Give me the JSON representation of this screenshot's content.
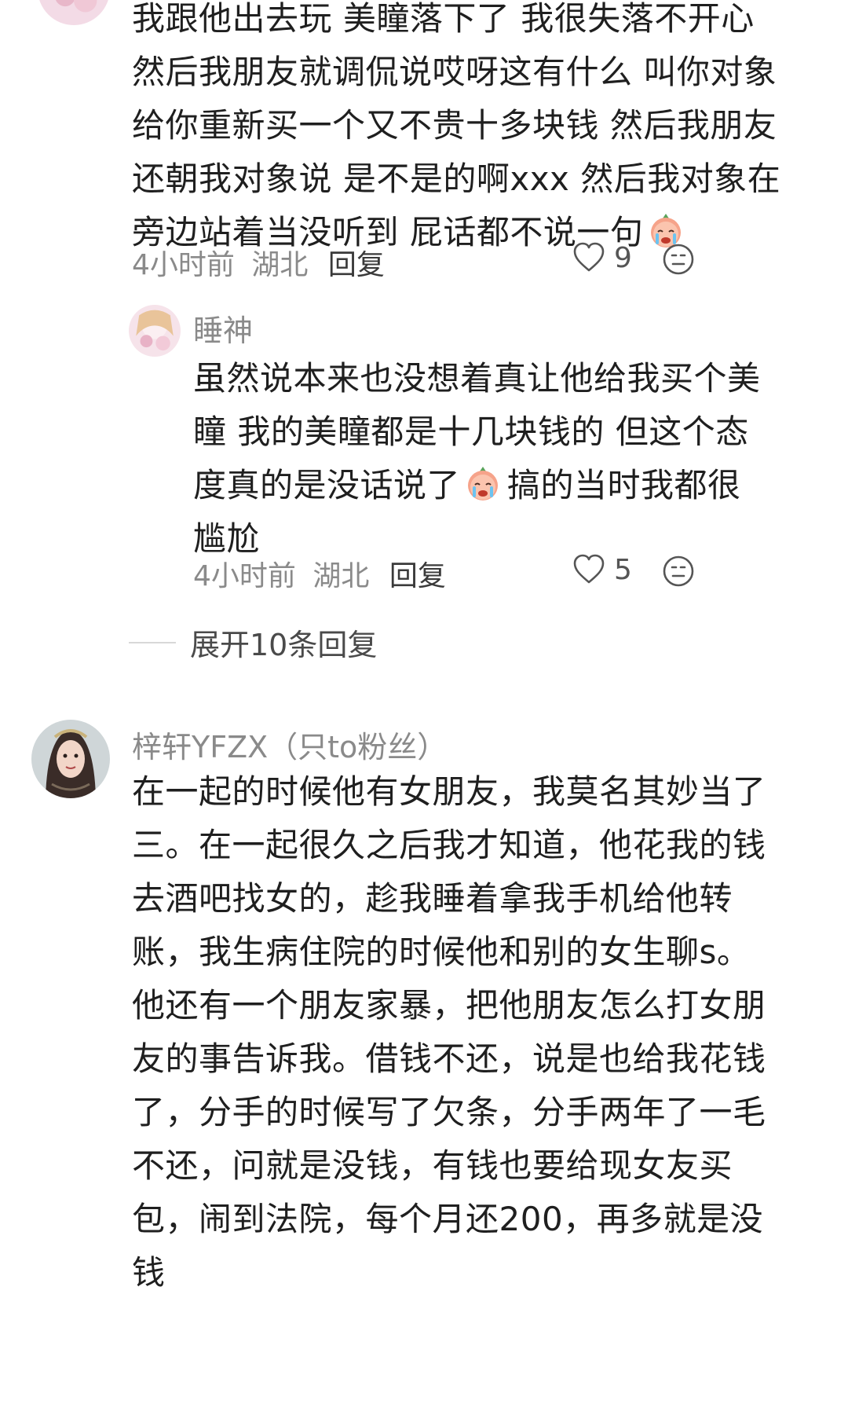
{
  "comment1": {
    "text_lines": [
      "我跟他出去玩 美瞳落下了 我很失落不开心",
      "然后我朋友就调侃说哎呀这有什么 叫你对象",
      "给你重新买一个又不贵十多块钱 然后我朋友",
      "还朝我对象说 是不是的啊xxx 然后我对象在",
      "旁边站着当没听到 屁话都不说一句"
    ],
    "time": "4小时前",
    "location": "湖北",
    "reply_label": "回复",
    "likes": "9"
  },
  "reply1": {
    "username": "睡神",
    "text_lines": [
      "虽然说本来也没想着真让他给我买个美",
      "瞳 我的美瞳都是十几块钱的 但这个态",
      "度真的是没话说了",
      "尴尬"
    ],
    "line3_suffix": "搞的当时我都很",
    "time": "4小时前",
    "location": "湖北",
    "reply_label": "回复",
    "likes": "5"
  },
  "expand_replies": {
    "label": "展开10条回复"
  },
  "comment2": {
    "username": "梓轩YFZX（只to粉丝）",
    "text_lines": [
      "在一起的时候他有女朋友，我莫名其妙当了",
      "三。在一起很久之后我才知道，他花我的钱",
      "去酒吧找女的，趁我睡着拿我手机给他转",
      "账，我生病住院的时候他和别的女生聊s。",
      "他还有一个朋友家暴，把他朋友怎么打女朋",
      "友的事告诉我。借钱不还，说是也给我花钱",
      "了，分手的时候写了欠条，分手两年了一毛",
      "不还，问就是没钱，有钱也要给现女友买",
      "包，闹到法院，每个月还200，再多就是没",
      "钱"
    ]
  },
  "icons": {
    "like": "heart-outline-icon",
    "react": "face-neutral-icon",
    "emoji": "crying-face-emoji-icon"
  }
}
